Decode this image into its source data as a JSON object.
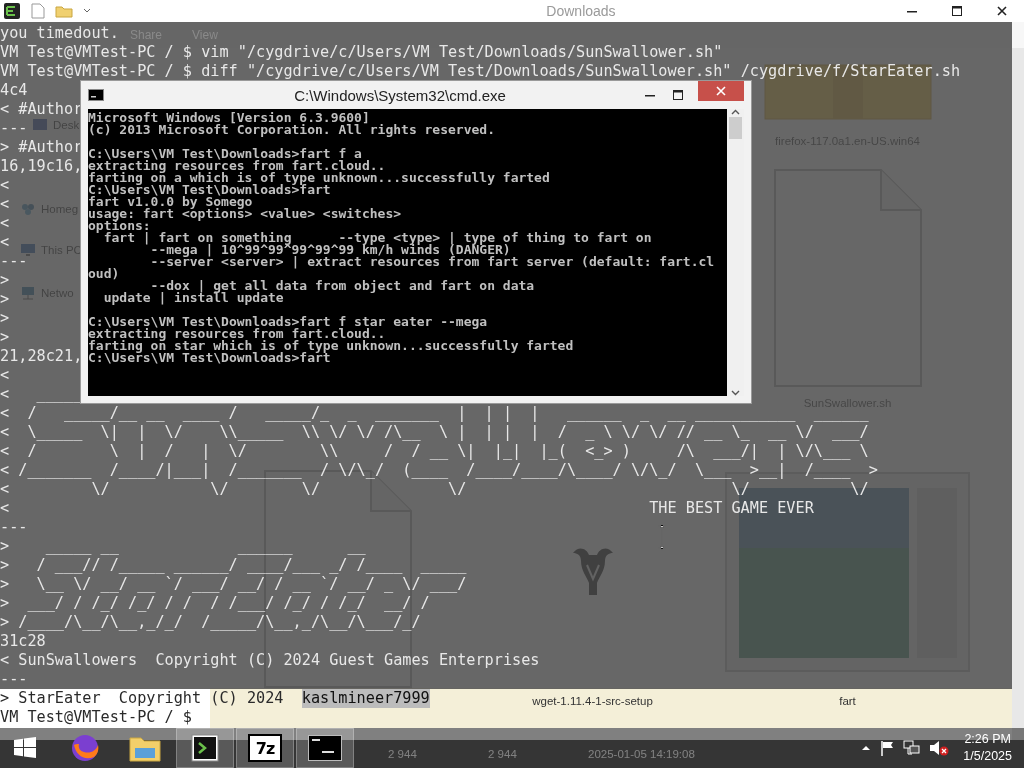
{
  "explorer": {
    "title": "Downloads",
    "ribbon_tabs": [
      {
        "label": "Share"
      },
      {
        "label": "View"
      }
    ],
    "nav_items": [
      {
        "kind": "desktop",
        "label": "Desk"
      },
      {
        "kind": "homegroup",
        "label": "Homeg"
      },
      {
        "kind": "computer",
        "label": "This PC"
      },
      {
        "kind": "network",
        "label": "Netwo"
      }
    ],
    "files": [
      {
        "kind": "archive",
        "name": "firefox-117.0a1.en-US.win64"
      },
      {
        "kind": "document",
        "name": "SunSwallower.sh"
      },
      {
        "kind": "document"
      },
      {
        "kind": "program",
        "name": "wget-1.11.4-1-src-setup"
      },
      {
        "kind": "preview",
        "name": "fart"
      }
    ],
    "details": [
      "2 944",
      "2 944",
      "2025-01-05 14:19:08"
    ]
  },
  "terminal": {
    "lines": [
      {
        "text": "you timedout."
      },
      {
        "text": "VM Test@VMTest-PC / $ vim \"/cygdrive/c/Users/VM Test/Downloads/SunSwallower.sh\""
      },
      {
        "text": "VM Test@VMTest-PC / $ diff \"/cygdrive/c/Users/VM Test/Downloads/SunSwallower.sh\" /cygdrive/f/StarEater.sh"
      },
      {
        "text": "4c4"
      },
      {
        "text": "< #Author"
      },
      {
        "text": "---"
      },
      {
        "text": "> #Author"
      },
      {
        "text": "16,19c16,"
      },
      {
        "text": "<"
      },
      {
        "text": "<"
      },
      {
        "text": "<"
      },
      {
        "text": "<"
      },
      {
        "text": "---"
      },
      {
        "text": ">"
      },
      {
        "text": ">"
      },
      {
        "text": ">"
      },
      {
        "text": ">"
      },
      {
        "text": "21,28c21,"
      },
      {
        "text": "<"
      },
      {
        "text": "<   _____"
      },
      {
        "text": "<  /   _____/__ __  ____ /   _____/_  _  _______  |  | |  |   ______  _  __ ___________  ______"
      },
      {
        "text": "<  \\_____  \\|  |  \\/    \\\\_____  \\\\ \\/ \\/ /\\__  \\ |  | |  |  /  _ \\ \\/ \\/ // __ \\_  __ \\/  ___/"
      },
      {
        "text": "<  /        \\  |  /   |  \\/        \\\\     /  / __ \\|  |_|  |_(  <_> )     /\\  ___/|  | \\/\\___ \\"
      },
      {
        "text": "< /_______  /____/|___|  /_______  / \\/\\_/  (____  /____/____/\\____/ \\/\\_/  \\___  >__|  /____  >"
      },
      {
        "text": "<         \\/           \\/        \\/              \\/                             \\/           \\/"
      },
      {
        "text": "<",
        "aside": "THE BEST GAME EVER"
      },
      {
        "text": "---"
      },
      {
        "text": ">    _____ __             ______      __"
      },
      {
        "text": ">   / ___// /_____ ______/ ____/___ _/ /____  _____"
      },
      {
        "text": ">   \\__ \\/ __/ __ `/ ___/ __/ / __ `/ __/ _ \\/ ___/"
      },
      {
        "text": ">  ___/ / /_/ /_/ / /  / /___/ /_/ / /_/  __/ /"
      },
      {
        "text": "> /____/\\__/\\__,_/_/  /_____/\\__,_/\\__/\\___/_/"
      },
      {
        "text": "31c28"
      },
      {
        "text": "< SunSwallowers  Copyright (C) 2024 Guest Games Enterprises"
      },
      {
        "text": "---"
      },
      {
        "segments": [
          {
            "text": "> StarEater  Copyright (C) 2024",
            "selected": false
          },
          {
            "text": "kaslmineer7999",
            "selected": true
          }
        ]
      },
      {
        "text": "VM Test@VMTest-PC / $"
      }
    ]
  },
  "cmd": {
    "title": "C:\\Windows\\System32\\cmd.exe",
    "blocks": [
      [
        "Microsoft Windows [Version 6.3.9600]",
        "(c) 2013 Microsoft Corporation. All rights reserved."
      ],
      [
        "C:\\Users\\VM Test\\Downloads>fart f a",
        "extracting resources from fart.cloud..",
        "farting on a which is of type unknown...successfully farted",
        "C:\\Users\\VM Test\\Downloads>fart",
        "fart v1.0.0 by Somego",
        "usage: fart <options> <value> <switches>",
        "options:",
        "  fart | fart on something      --type <type> | type of thing to fart on",
        "        --mega | 10^99^99^99^99^99 km/h winds (DANGER)",
        "        --server <server> | extract resources from fart server (default: fart.cl",
        "oud)",
        "        --dox | get all data from object and fart on data",
        "  update | install update"
      ],
      [
        "C:\\Users\\VM Test\\Downloads>fart f star eater --mega",
        "extracting resources from fart.cloud..",
        "farting on star which is of type unknown...successfully farted",
        "C:\\Users\\VM Test\\Downloads>fart"
      ]
    ]
  },
  "taskbar": {
    "apps": [
      {
        "kind": "firefox",
        "active": false
      },
      {
        "kind": "folder",
        "active": false
      },
      {
        "kind": "terminal",
        "active": true
      },
      {
        "kind": "archiver",
        "label": "7z",
        "active": true
      },
      {
        "kind": "console",
        "active": true
      }
    ],
    "tray": {
      "volume_muted": true
    },
    "clock": {
      "time": "2:26 PM",
      "date": "1/5/2025"
    }
  }
}
